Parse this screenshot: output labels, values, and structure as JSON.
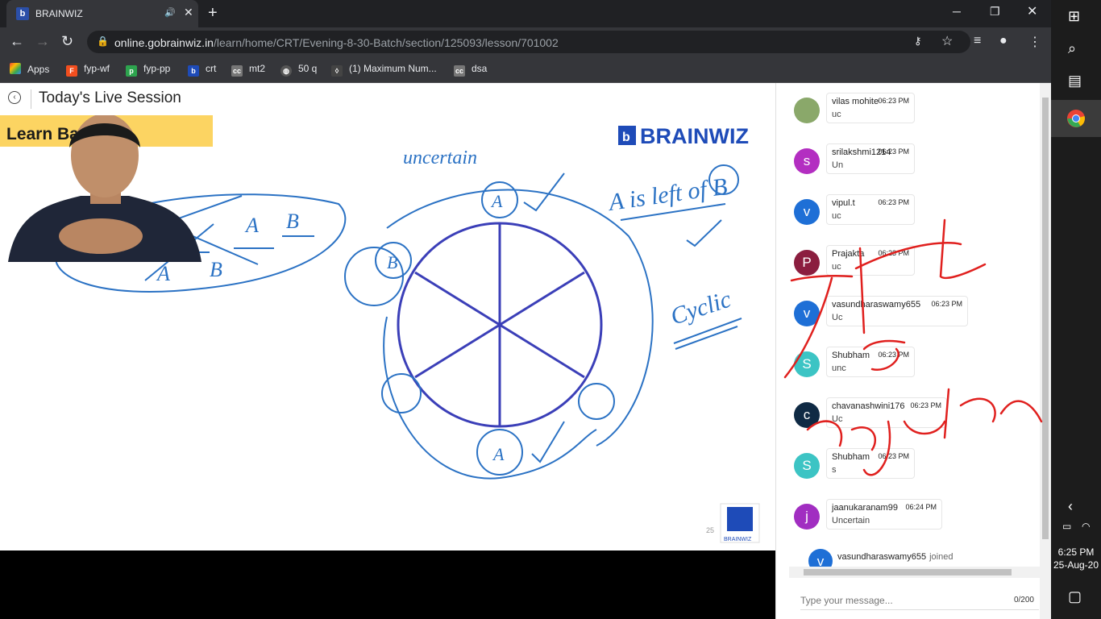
{
  "browser": {
    "tab_title": "BRAINWIZ",
    "tab_favicon": "b",
    "url_host": "online.gobrainwiz.in",
    "url_path": "/learn/home/CRT/Evening-8-30-Batch/section/125093/lesson/701002",
    "bookmarks": [
      "Apps",
      "fyp-wf",
      "fyp-pp",
      "crt",
      "mt2",
      "50 q",
      "(1) Maximum Num...",
      "dsa"
    ]
  },
  "session": {
    "title": "Today's Live Session"
  },
  "slide": {
    "heading": "Learn Basics",
    "logo": "BRAINWIZ",
    "page_number": "25",
    "corner_logo": "BRAINWIZ",
    "annotations": {
      "uncertain": "uncertain",
      "left_of": "A is left of B",
      "cyclic": "Cyclic",
      "a": "A",
      "b": "B"
    }
  },
  "chat": {
    "messages": [
      {
        "initial": "",
        "name": "vilas mohite",
        "time": "06:23 PM",
        "text": "uc",
        "color": "#8aa86a"
      },
      {
        "initial": "s",
        "name": "srilakshmi1214",
        "time": "06:23 PM",
        "text": "Un",
        "color": "#b32ec1"
      },
      {
        "initial": "v",
        "name": "vipul.t",
        "time": "06:23 PM",
        "text": "uc",
        "color": "#1e6fd6"
      },
      {
        "initial": "P",
        "name": "Prajakta",
        "time": "06:23 PM",
        "text": "uc",
        "color": "#8b1e3f"
      },
      {
        "initial": "v",
        "name": "vasundharaswamy655",
        "time": "06:23 PM",
        "text": "Uc",
        "color": "#1e6fd6"
      },
      {
        "initial": "S",
        "name": "Shubham",
        "time": "06:23 PM",
        "text": "unc",
        "color": "#3cc4c4"
      },
      {
        "initial": "c",
        "name": "chavanashwini176",
        "time": "06:23 PM",
        "text": "Uc",
        "color": "#0f2a44"
      },
      {
        "initial": "S",
        "name": "Shubham",
        "time": "06:23 PM",
        "text": "s",
        "color": "#3cc4c4"
      },
      {
        "initial": "j",
        "name": "jaanukaranam99",
        "time": "06:24 PM",
        "text": "Uncertain",
        "color": "#a12ec1"
      }
    ],
    "joined_user": "vasundharaswamy655",
    "joined_label": "joined",
    "joined_initial": "v",
    "input_placeholder": "Type your message...",
    "char_count": "0/200"
  },
  "taskbar": {
    "time": "6:25 PM",
    "date": "25-Aug-20"
  }
}
